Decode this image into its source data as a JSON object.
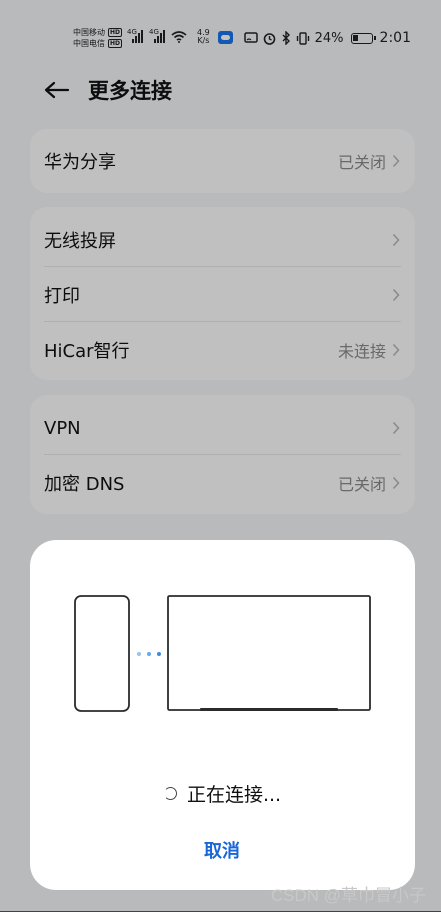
{
  "status_bar": {
    "carrier_1": "中国移动",
    "carrier_2": "中国电信",
    "hd_badge": "HD",
    "sig_label": "4G",
    "net_speed_value": "4.9",
    "net_speed_unit": "K/s",
    "battery_percent": "24%",
    "time": "2:01",
    "icons": [
      "signal-icon",
      "wifi-icon",
      "cloud-icon",
      "cast-icon",
      "alarm-icon",
      "bluetooth-icon",
      "vibrate-icon",
      "battery-icon"
    ]
  },
  "header": {
    "title": "更多连接",
    "back_icon": "back-arrow-icon"
  },
  "cards": {
    "huawei_share": {
      "label": "华为分享",
      "value": "已关闭"
    },
    "wireless_projection": {
      "label": "无线投屏"
    },
    "print": {
      "label": "打印"
    },
    "hicar": {
      "label": "HiCar智行",
      "value": "未连接"
    },
    "vpn": {
      "label": "VPN"
    },
    "encrypted_dns": {
      "label": "加密 DNS",
      "value": "已关闭"
    }
  },
  "dialog": {
    "status_text": "正在连接...",
    "cancel_label": "取消"
  },
  "watermark": "CSDN @草巾冒小子",
  "colors": {
    "accent": "#1a66d6",
    "dots": "#4a90e2",
    "scrim": "rgba(0,0,0,0.235)"
  }
}
